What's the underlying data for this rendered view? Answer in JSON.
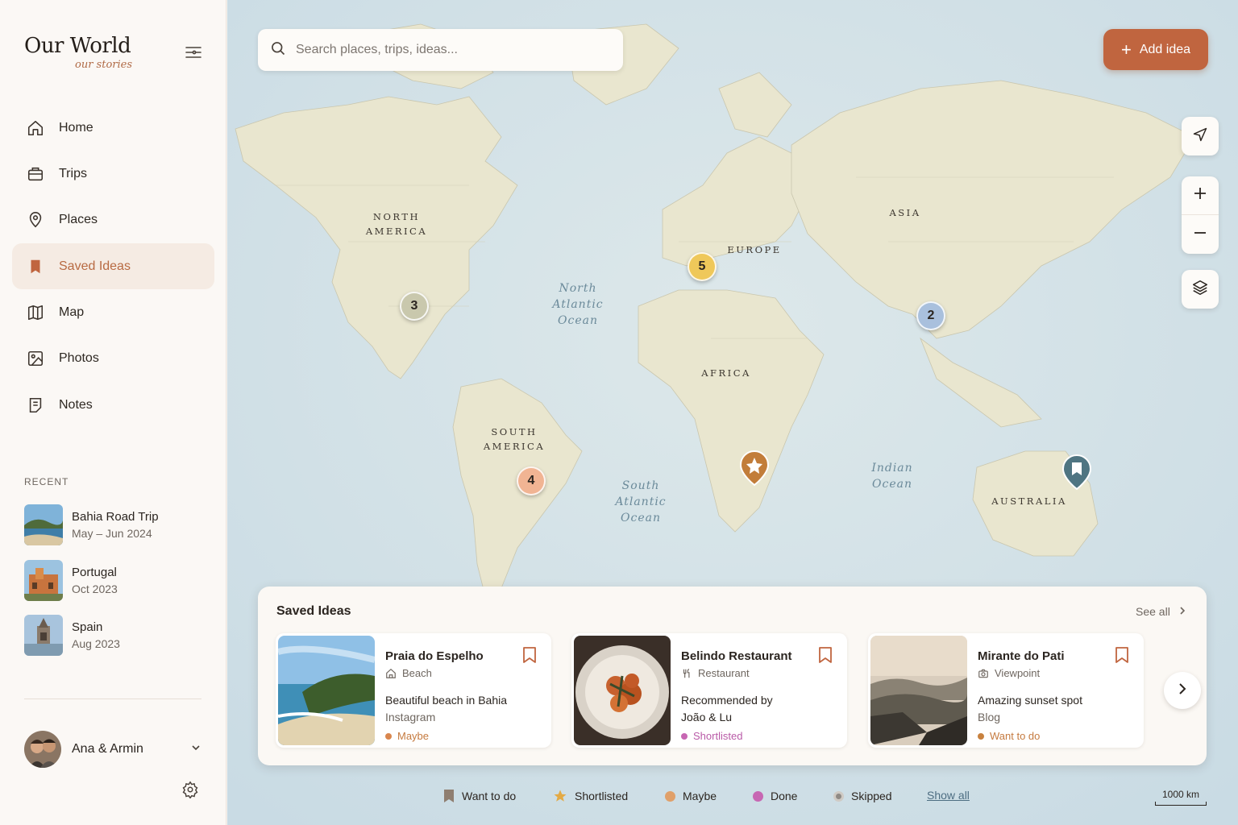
{
  "brand": {
    "title": "Our World",
    "subtitle": "our stories"
  },
  "nav": [
    {
      "label": "Home",
      "icon": "home-icon",
      "active": false
    },
    {
      "label": "Trips",
      "icon": "briefcase-icon",
      "active": false
    },
    {
      "label": "Places",
      "icon": "pin-icon",
      "active": false
    },
    {
      "label": "Saved Ideas",
      "icon": "bookmark-icon",
      "active": true
    },
    {
      "label": "Map",
      "icon": "map-icon",
      "active": false
    },
    {
      "label": "Photos",
      "icon": "image-icon",
      "active": false
    },
    {
      "label": "Notes",
      "icon": "notes-icon",
      "active": false
    }
  ],
  "recent": {
    "title": "RECENT",
    "items": [
      {
        "name": "Bahia Road Trip",
        "date": "May – Jun 2024"
      },
      {
        "name": "Portugal",
        "date": "Oct 2023"
      },
      {
        "name": "Spain",
        "date": "Aug 2023"
      }
    ]
  },
  "user": {
    "name": "Ana & Armin"
  },
  "search": {
    "placeholder": "Search places, trips, ideas..."
  },
  "add_button": {
    "label": "Add idea"
  },
  "map": {
    "continents": [
      {
        "name": "NORTH\nAMERICA"
      },
      {
        "name": "SOUTH\nAMERICA"
      },
      {
        "name": "EUROPE"
      },
      {
        "name": "AFRICA"
      },
      {
        "name": "ASIA"
      },
      {
        "name": "AUSTRALIA"
      }
    ],
    "oceans": [
      {
        "name": "North\nAtlantic\nOcean"
      },
      {
        "name": "South\nAtlantic\nOcean"
      },
      {
        "name": "Indian\nOcean"
      }
    ],
    "clusters": [
      {
        "count": "3",
        "color": "#c9c8ad"
      },
      {
        "count": "5",
        "color": "#efc85a"
      },
      {
        "count": "2",
        "color": "#a9c0dd"
      },
      {
        "count": "4",
        "color": "#f1b493"
      }
    ],
    "scale": "1000 km"
  },
  "saved_ideas": {
    "title": "Saved Ideas",
    "see_all": "See all",
    "cards": [
      {
        "name": "Praia do Espelho",
        "category": "Beach",
        "description": "Beautiful beach in Bahia",
        "source": "Instagram",
        "status": "Maybe",
        "status_color": "#d9864e"
      },
      {
        "name": "Belindo Restaurant",
        "category": "Restaurant",
        "description": "Recommended by João & Lu",
        "source": "",
        "status": "Shortlisted",
        "status_color": "#c767b3"
      },
      {
        "name": "Mirante do Pati",
        "category": "Viewpoint",
        "description": "Amazing sunset spot",
        "source": "Blog",
        "status": "Want to do",
        "status_color": "#c8813f"
      }
    ]
  },
  "legend": {
    "items": [
      {
        "label": "Want to do",
        "icon": "bookmark-icon"
      },
      {
        "label": "Shortlisted",
        "icon": "star-icon"
      },
      {
        "label": "Maybe",
        "color": "#e0a06a"
      },
      {
        "label": "Done",
        "color": "#c767b3"
      },
      {
        "label": "Skipped",
        "color": "#8f8a85"
      }
    ],
    "show_all": "Show all"
  },
  "colors": {
    "accent": "#c0653f",
    "sidebar_bg": "#fbf8f5",
    "active_bg": "#f5ebe3"
  }
}
